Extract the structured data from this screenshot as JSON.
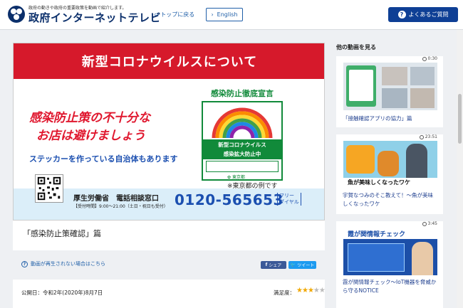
{
  "header": {
    "tagline": "政府の動きや政府の重要政策を動画で紹介します。",
    "site_name": "政府インターネットテレビ",
    "top_link": "トップに戻る",
    "english": "English",
    "faq": "よくあるご質問"
  },
  "video": {
    "banner": "新型コロナウイルスについて",
    "line1": "感染防止策の不十分な",
    "line2": "お店は避けましょう",
    "line3": "ステッカーを作っている自治体もあります",
    "sticker_head": "感染防止徹底宣言",
    "sticker_green": "新型コロナウイルス\n感染拡大防止中",
    "sticker_tokyo": "東京都",
    "sticker_note": "※東京都の例です",
    "ministry": "厚生労働省　電話相談窓口",
    "hours": "【受付時間】9:00〜21:00（土日・祝日も受付）",
    "phone": "0120-565653",
    "free_dial": "フリー\nダイヤル"
  },
  "main": {
    "video_title": "「感染防止策確認」篇",
    "help": "動画が再生されない場合はこちら",
    "share_fb": "シェア",
    "share_tw": "ツイート",
    "pub_date": "公開日：令和2年(2020年)8月7日",
    "rating_label": "満足度：",
    "rating": 3,
    "rating_max": 5
  },
  "sidebar": {
    "title": "他の動画を見る",
    "items": [
      {
        "duration": "0:30",
        "caption": "「接触確認アプリの協力」篇"
      },
      {
        "duration": "23:51",
        "caption": "宇賀なつみのそこ教えて！～魚が美味しくなったワケ",
        "thumb_text": "魚が美味しくなったワケ"
      },
      {
        "duration": "3:45",
        "caption": "霞が関情報チェック～IoT機器を脅威から守るNOTICE",
        "thumb_text": "霞が関情報チェック"
      }
    ]
  },
  "colors": {
    "brand": "#0b2f6b",
    "accent": "#0e3f95",
    "banner_red": "#d6192b",
    "sticker_green": "#118a3a",
    "star": "#f1a800"
  }
}
